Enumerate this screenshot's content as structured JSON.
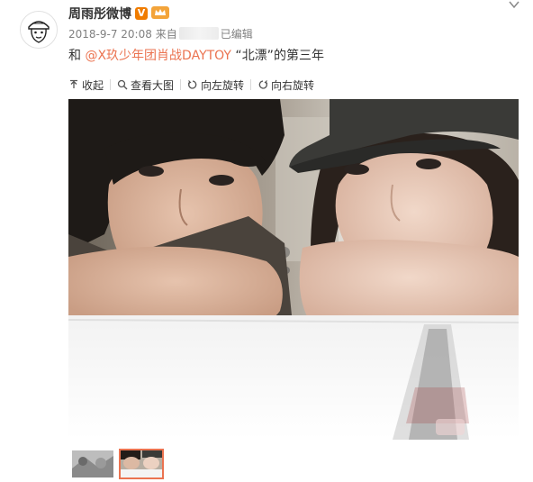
{
  "post": {
    "username": "周雨彤微博",
    "verified_badge": "V",
    "date": "2018-9-7 20:08",
    "source_prefix": "来自",
    "edited": "已编辑",
    "text_prefix": "和 ",
    "mention": "@X玖少年团肖战DAYTOY",
    "text_suffix": " “北漂”的第三年"
  },
  "toolbar": {
    "collapse": "收起",
    "view_large": "查看大图",
    "rotate_left": "向左旋转",
    "rotate_right": "向右旋转"
  },
  "colors": {
    "accent": "#eb7350",
    "badge": "#f07c00",
    "meta_text": "#808080"
  },
  "thumbnails": [
    "thumb-1",
    "thumb-2"
  ],
  "selected_thumbnail": 2
}
